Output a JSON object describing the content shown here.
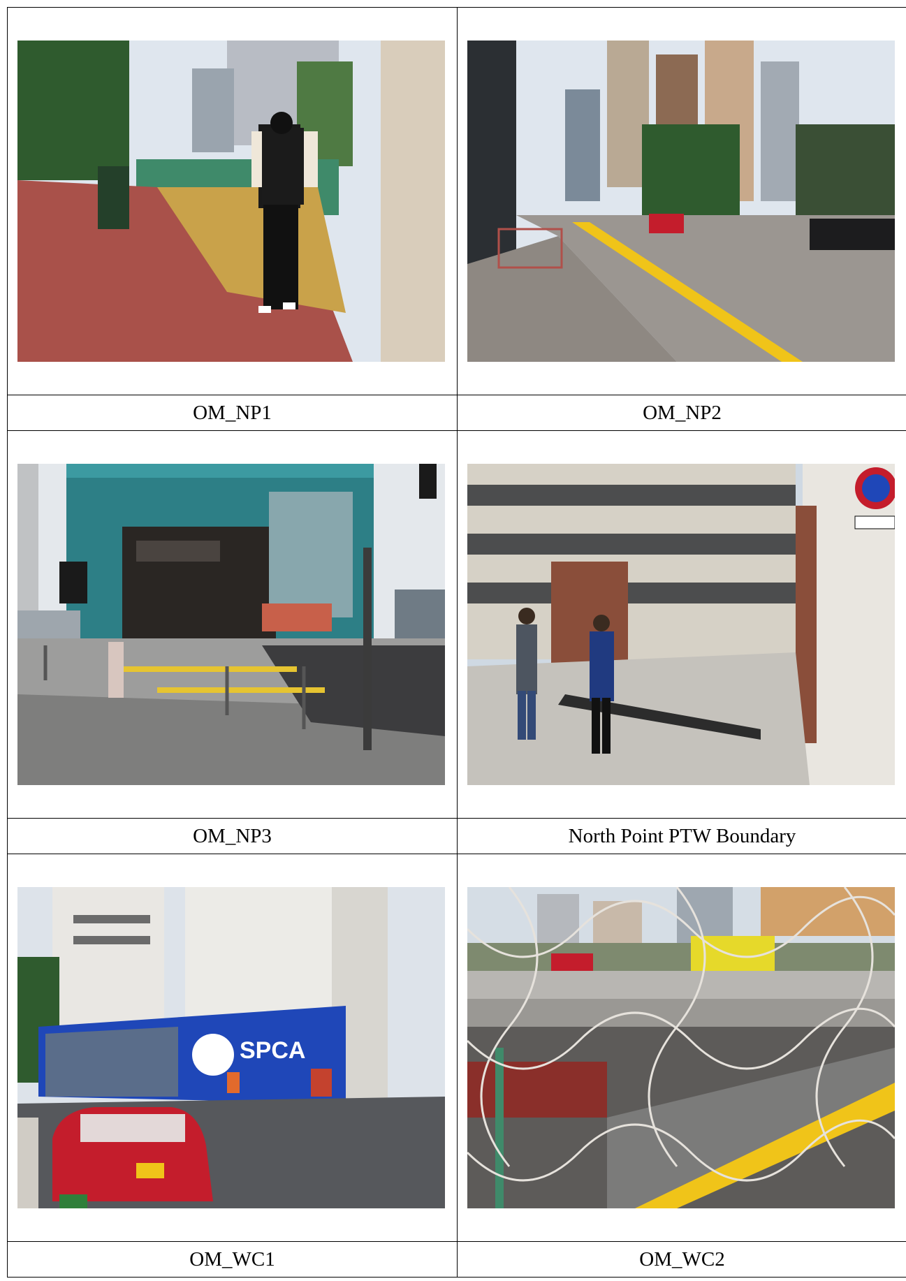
{
  "photos": [
    {
      "caption": "OM_NP1",
      "sign_text": ""
    },
    {
      "caption": "OM_NP2",
      "sign_text": ""
    },
    {
      "caption": "OM_NP3",
      "sign_text": ""
    },
    {
      "caption": "North Point PTW Boundary",
      "sign_text": ""
    },
    {
      "caption": "OM_WC1",
      "sign_text": "SPCA"
    },
    {
      "caption": "OM_WC2",
      "sign_text": ""
    }
  ],
  "colors": {
    "border": "#000000",
    "sky": "#dfe6ee",
    "brick": "#a9514a",
    "tree": "#2f5b2e",
    "spca_blue": "#1f47b8",
    "taxi_red": "#c41d2c",
    "rail_yellow": "#f0c419"
  }
}
